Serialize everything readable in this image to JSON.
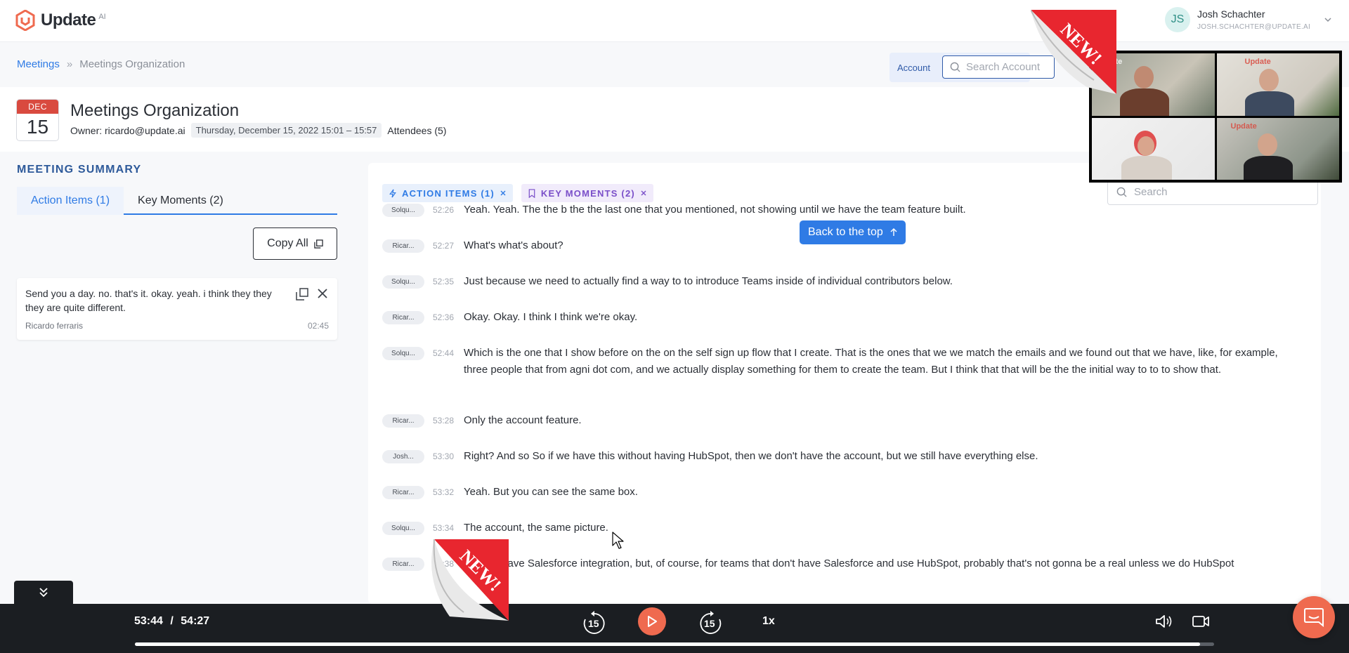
{
  "app": {
    "logo_text": "Update",
    "logo_suffix": "AI"
  },
  "user": {
    "initials": "JS",
    "name": "Josh Schachter",
    "email": "JOSH.SCHACHTER@UPDATE.AI"
  },
  "breadcrumb": {
    "root": "Meetings",
    "separator": "»",
    "current": "Meetings Organization"
  },
  "account": {
    "label": "Account",
    "search_placeholder": "Search Account"
  },
  "meeting": {
    "month": "DEC",
    "day": "15",
    "title": "Meetings Organization",
    "owner": "Owner: ricardo@update.ai",
    "datetime": "Thursday, December 15, 2022 15:01 – 15:57",
    "attendees": "Attendees (5)"
  },
  "summary": {
    "title": "MEETING SUMMARY",
    "tabs": [
      {
        "label": "Action Items (1)"
      },
      {
        "label": "Key Moments (2)"
      }
    ],
    "copy_all": "Copy All",
    "action_item": {
      "text": "Send you a day. no. that's it. okay. yeah. i think they they they are quite different.",
      "author": "Ricardo ferraris",
      "time": "02:45"
    }
  },
  "transcript": {
    "filters": [
      {
        "label": "ACTION ITEMS (1)",
        "icon": "bolt-icon"
      },
      {
        "label": "KEY MOMENTS (2)",
        "icon": "bookmark-icon"
      }
    ],
    "search_placeholder": "Search",
    "back_to_top": "Back to the top",
    "rows": [
      {
        "speaker": "Solqu...",
        "time": "52:26",
        "text": "Yeah. Yeah. The the b the the last one that you mentioned, not showing until we have the team feature built."
      },
      {
        "speaker": "Ricar...",
        "time": "52:27",
        "text": "What's what's about?"
      },
      {
        "speaker": "Solqu...",
        "time": "52:35",
        "text": "Just because we need to actually find a way to to introduce Teams inside of individual contributors below."
      },
      {
        "speaker": "Ricar...",
        "time": "52:36",
        "text": "Okay. Okay. I think I think we're okay."
      },
      {
        "speaker": "Solqu...",
        "time": "52:44",
        "text": "Which is the one that I show before on the on the self sign up flow that I create. That is the ones that we we match the emails and we found out that we have, like, for example, three people that from agni dot com, and we actually display something for them to create the team. But I think that that will be the the initial way to to to show that."
      },
      {
        "speaker": "Ricar...",
        "time": "53:28",
        "text": "Only the account feature."
      },
      {
        "speaker": "Josh...",
        "time": "53:30",
        "text": "Right? And so So if we have this without having HubSpot, then we don't have the account, but we still have everything else."
      },
      {
        "speaker": "Ricar...",
        "time": "53:32",
        "text": "Yeah. But you can see the same box."
      },
      {
        "speaker": "Solqu...",
        "time": "53:34",
        "text": "The account, the same picture."
      },
      {
        "speaker": "Ricar...",
        "time": "53:38",
        "text": "And we have Salesforce integration, but, of course, for teams that don't have Salesforce and use HubSpot, probably that's not gonna be a real unless we do HubSpot"
      }
    ]
  },
  "player": {
    "current_time": "53:44",
    "separator": "/",
    "total_time": "54:27",
    "skip_back": "15",
    "skip_forward": "15",
    "speed": "1x",
    "progress": 0.987
  },
  "badges": {
    "new_label": "NEW!"
  },
  "colors": {
    "accent": "#2f7be5",
    "brand": "#ef6a4f",
    "new_badge": "#e8262f"
  }
}
